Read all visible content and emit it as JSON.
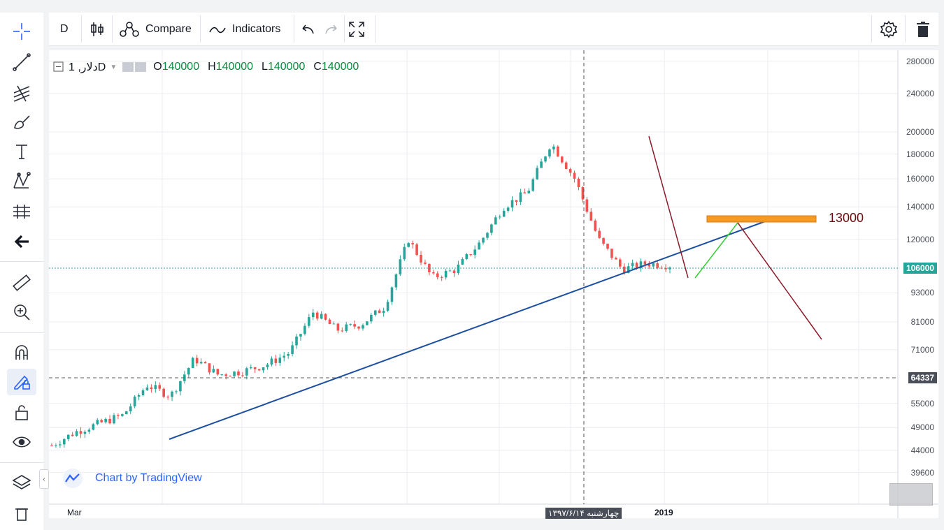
{
  "toolbar": {
    "interval": "D",
    "compare": "Compare",
    "indicators": "Indicators"
  },
  "sidebar": {
    "tools": [
      "crosshair-icon",
      "trend-line-icon",
      "pitchfork-icon",
      "brush-icon",
      "text-icon",
      "pattern-icon",
      "prediction-icon",
      "back-arrow-icon",
      "ruler-icon",
      "zoom-in-icon",
      "magnet-icon",
      "lock-drawing-icon",
      "unlock-icon",
      "eye-icon",
      "layers-icon",
      "trash-icon"
    ]
  },
  "legend": {
    "symbol": "دلار, 1D",
    "o_label": "O",
    "o": "140000",
    "h_label": "H",
    "h": "140000",
    "l_label": "L",
    "l": "140000",
    "c_label": "C",
    "c": "140000"
  },
  "price_scale": [
    "280000",
    "240000",
    "200000",
    "180000",
    "160000",
    "140000",
    "120000",
    "93000",
    "81000",
    "71000",
    "55000",
    "49000",
    "44000",
    "39600"
  ],
  "last_price": "106000",
  "crosshair_price": "64337",
  "time_axis": {
    "start": "Mar",
    "crosshair_date": "چهارشنبه ۱۳۹۷/۶/۱۴",
    "year": "2019"
  },
  "annotation": "13000",
  "watermark": "Chart by TradingView",
  "colors": {
    "up": "#26a69a",
    "down": "#ef5350",
    "trend": "#1d4fa0",
    "zone": "#f59a23"
  },
  "chart_data": {
    "type": "candlestick",
    "symbol": "دلار, 1D",
    "y_scale": "log",
    "ylim": [
      37000,
      290000
    ],
    "close_path": [
      {
        "x": "Mar",
        "y": 45000
      },
      {
        "y": 48000
      },
      {
        "y": 50000
      },
      {
        "y": 52000
      },
      {
        "y": 60000
      },
      {
        "y": 57000
      },
      {
        "y": 68000
      },
      {
        "y": 63000
      },
      {
        "y": 64000
      },
      {
        "y": 66000
      },
      {
        "y": 70000
      },
      {
        "y": 85000
      },
      {
        "y": 78000
      },
      {
        "y": 80000
      },
      {
        "y": 87000
      },
      {
        "y": 120000
      },
      {
        "y": 100000
      },
      {
        "y": 104000
      },
      {
        "y": 118000
      },
      {
        "y": 140000
      },
      {
        "y": 150000
      },
      {
        "y": 190000
      },
      {
        "y": 160000
      },
      {
        "y": 120000
      },
      {
        "y": 104000
      },
      {
        "y": 107000
      },
      {
        "x": "2019",
        "y": 106000
      }
    ]
  }
}
